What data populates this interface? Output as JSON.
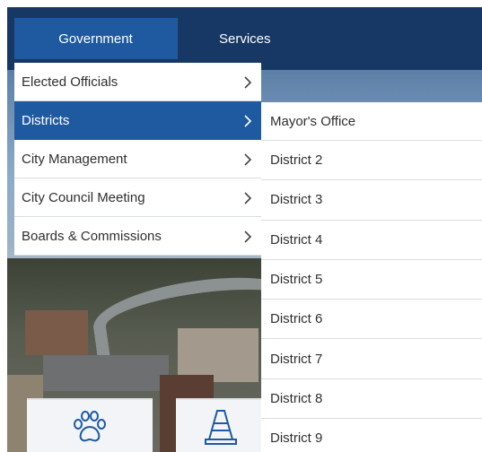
{
  "topnav": {
    "tabs": [
      {
        "label": "Government",
        "active": true
      },
      {
        "label": "Services",
        "active": false
      }
    ],
    "background_color": "#173764",
    "active_color": "#1f5aa0"
  },
  "menu": {
    "items": [
      {
        "label": "Elected Officials",
        "icon": "chevron-right-icon"
      },
      {
        "label": "Districts",
        "icon": "chevron-right-icon",
        "active": true
      },
      {
        "label": "City Management",
        "icon": "chevron-right-icon"
      },
      {
        "label": "City Council Meeting",
        "icon": "chevron-right-icon"
      },
      {
        "label": "Boards & Commissions",
        "icon": "chevron-right-icon"
      }
    ]
  },
  "submenu": {
    "items": [
      {
        "label": "Mayor's Office"
      },
      {
        "label": "District 2"
      },
      {
        "label": "District 3"
      },
      {
        "label": "District 4"
      },
      {
        "label": "District 5"
      },
      {
        "label": "District 6"
      },
      {
        "label": "District 7"
      },
      {
        "label": "District 8"
      },
      {
        "label": "District 9"
      }
    ]
  },
  "quick_links": [
    {
      "icon": "paw-icon"
    },
    {
      "icon": "traffic-cone-icon"
    }
  ]
}
